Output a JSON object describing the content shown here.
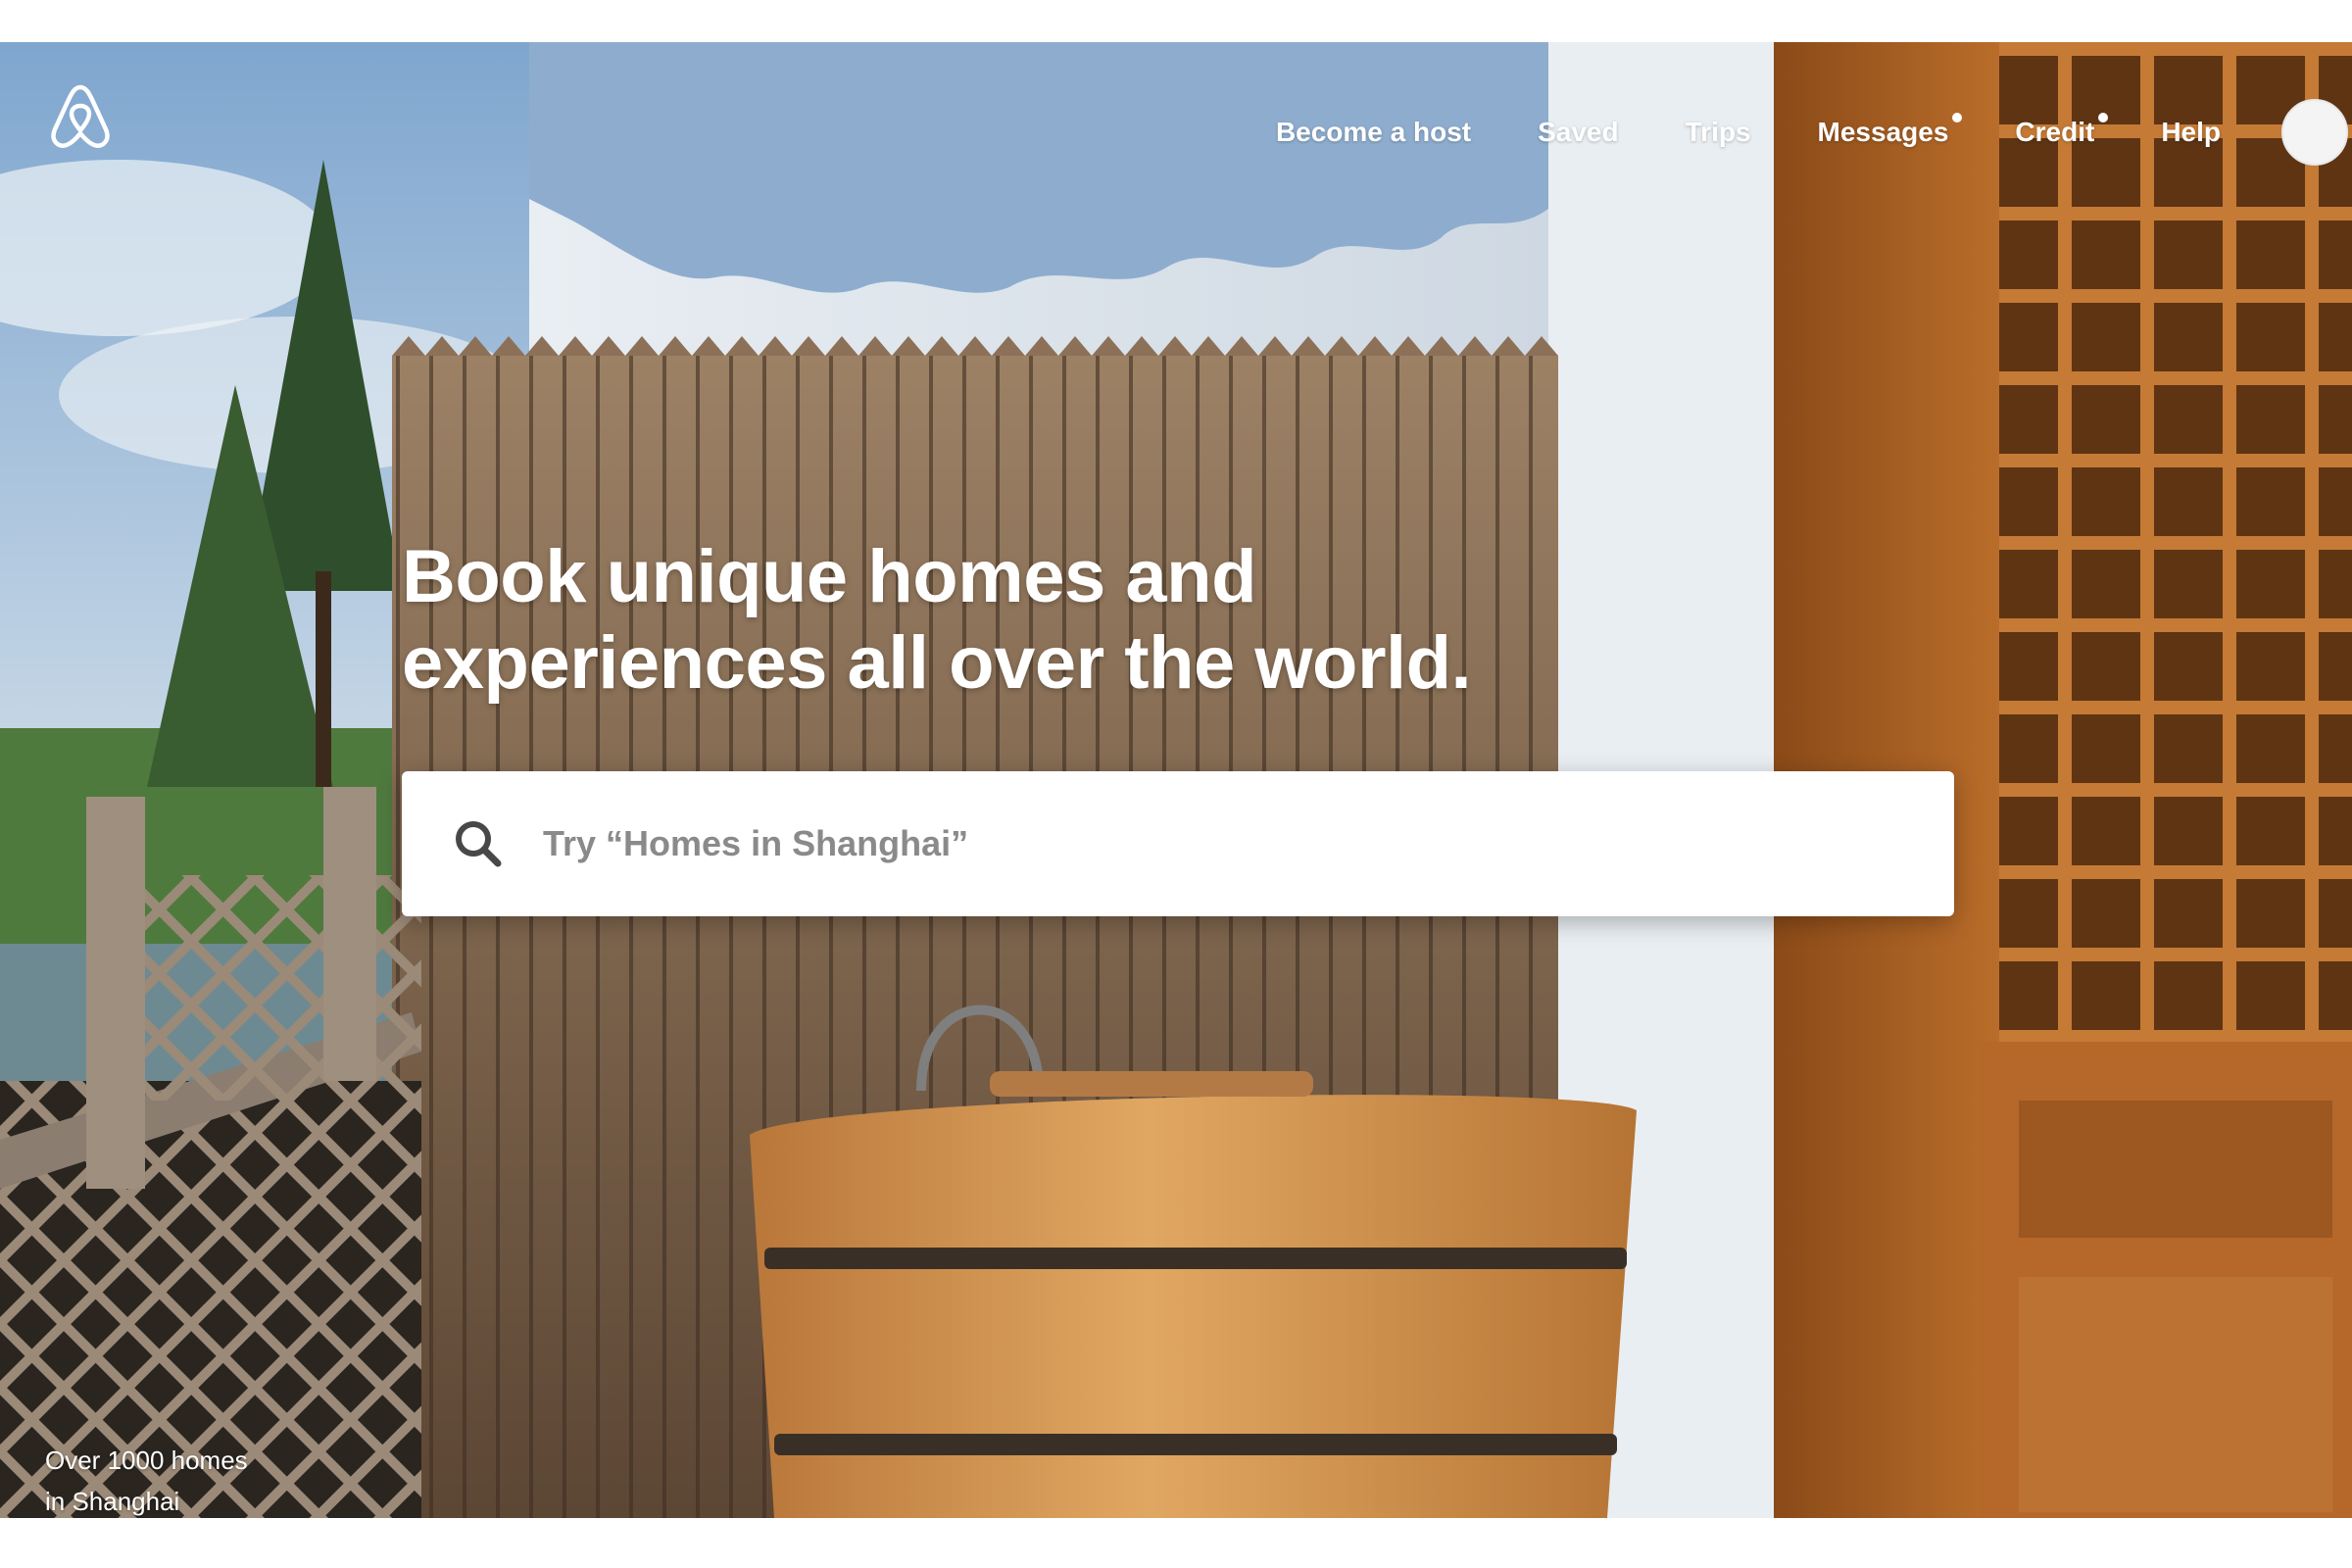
{
  "brand": {
    "logo_icon": "airbnb-belo-icon"
  },
  "nav": {
    "items": [
      {
        "label": "Become a host",
        "has_dot": false
      },
      {
        "label": "Saved",
        "has_dot": false
      },
      {
        "label": "Trips",
        "has_dot": false
      },
      {
        "label": "Messages",
        "has_dot": true
      },
      {
        "label": "Credit",
        "has_dot": true
      },
      {
        "label": "Help",
        "has_dot": false
      }
    ],
    "avatar_icon": "user-avatar"
  },
  "hero": {
    "headline_line1": "Book unique homes and",
    "headline_line2": "experiences all over the world.",
    "caption_line1": "Over 1000 homes",
    "caption_line2": "in Shanghai"
  },
  "search": {
    "placeholder": "Try “Homes in Shanghai”",
    "icon": "search-icon"
  },
  "colors": {
    "text_on_image": "#ffffff",
    "search_text": "#484848",
    "placeholder": "#8a8a8a"
  }
}
